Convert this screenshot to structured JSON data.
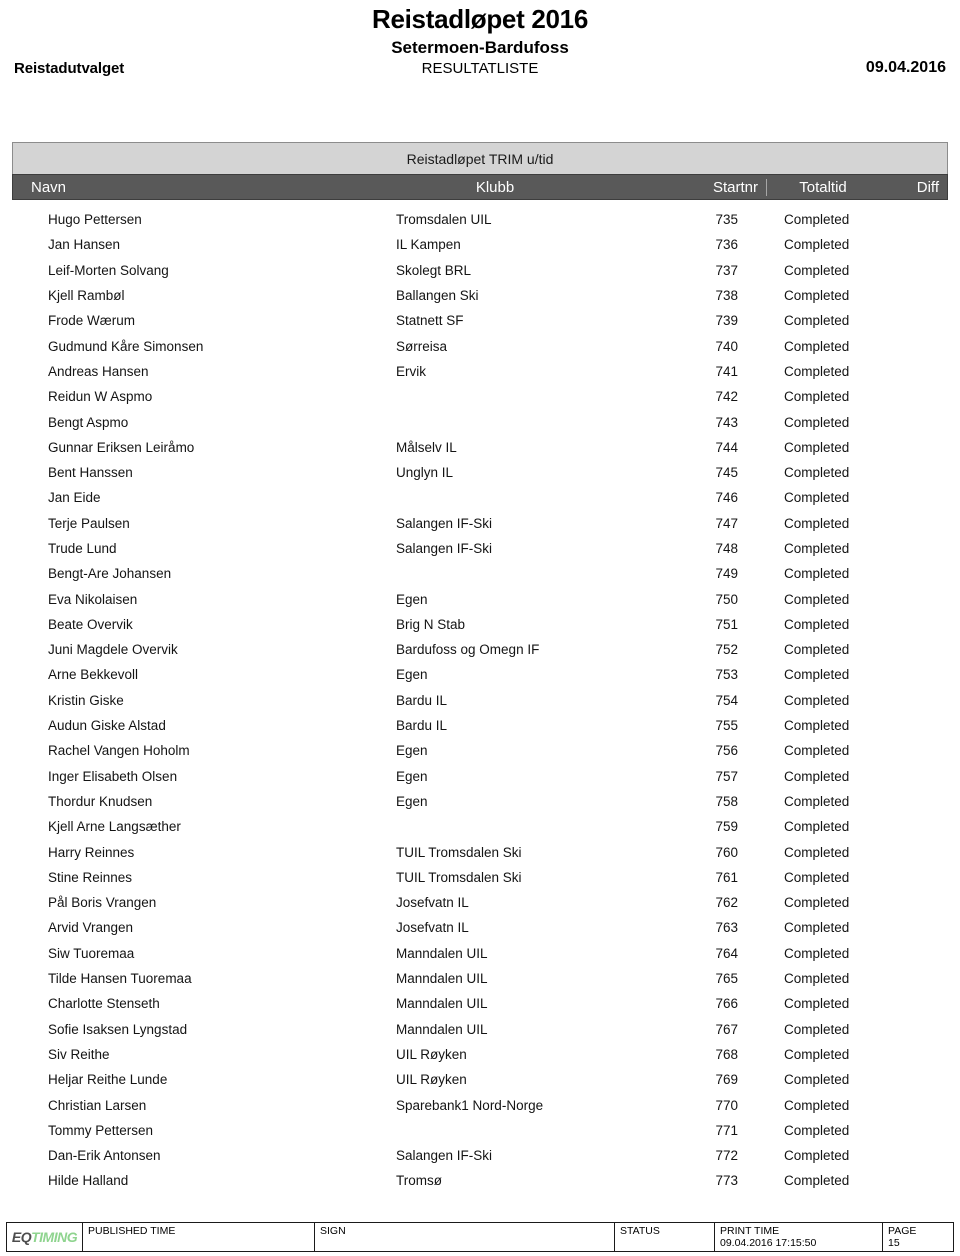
{
  "header": {
    "organizer": "Reistadutvalget",
    "event_title": "Reistadløpet 2016",
    "event_subtitle": "Setermoen-Bardufoss",
    "document_kind": "RESULTATLISTE",
    "date": "09.04.2016"
  },
  "table": {
    "class_band": "Reistadløpet TRIM u/tid",
    "columns": {
      "navn": "Navn",
      "klubb": "Klubb",
      "startnr": "Startnr",
      "totaltid": "Totaltid",
      "diff": "Diff"
    },
    "rows": [
      {
        "navn": "Hugo Pettersen",
        "klubb": "Tromsdalen UIL",
        "startnr": "735",
        "totaltid": "Completed",
        "diff": ""
      },
      {
        "navn": "Jan Hansen",
        "klubb": "IL Kampen",
        "startnr": "736",
        "totaltid": "Completed",
        "diff": ""
      },
      {
        "navn": "Leif-Morten Solvang",
        "klubb": "Skolegt BRL",
        "startnr": "737",
        "totaltid": "Completed",
        "diff": ""
      },
      {
        "navn": "Kjell Rambøl",
        "klubb": "Ballangen Ski",
        "startnr": "738",
        "totaltid": "Completed",
        "diff": ""
      },
      {
        "navn": "Frode Wærum",
        "klubb": "Statnett SF",
        "startnr": "739",
        "totaltid": "Completed",
        "diff": ""
      },
      {
        "navn": "Gudmund Kåre Simonsen",
        "klubb": "Sørreisa",
        "startnr": "740",
        "totaltid": "Completed",
        "diff": ""
      },
      {
        "navn": "Andreas Hansen",
        "klubb": "Ervik",
        "startnr": "741",
        "totaltid": "Completed",
        "diff": ""
      },
      {
        "navn": "Reidun W Aspmo",
        "klubb": "",
        "startnr": "742",
        "totaltid": "Completed",
        "diff": ""
      },
      {
        "navn": "Bengt Aspmo",
        "klubb": "",
        "startnr": "743",
        "totaltid": "Completed",
        "diff": ""
      },
      {
        "navn": "Gunnar Eriksen Leiråmo",
        "klubb": "Målselv IL",
        "startnr": "744",
        "totaltid": "Completed",
        "diff": ""
      },
      {
        "navn": "Bent Hanssen",
        "klubb": "Unglyn IL",
        "startnr": "745",
        "totaltid": "Completed",
        "diff": ""
      },
      {
        "navn": "Jan Eide",
        "klubb": "",
        "startnr": "746",
        "totaltid": "Completed",
        "diff": ""
      },
      {
        "navn": "Terje Paulsen",
        "klubb": "Salangen IF-Ski",
        "startnr": "747",
        "totaltid": "Completed",
        "diff": ""
      },
      {
        "navn": "Trude Lund",
        "klubb": "Salangen IF-Ski",
        "startnr": "748",
        "totaltid": "Completed",
        "diff": ""
      },
      {
        "navn": "Bengt-Are Johansen",
        "klubb": "",
        "startnr": "749",
        "totaltid": "Completed",
        "diff": ""
      },
      {
        "navn": "Eva Nikolaisen",
        "klubb": "Egen",
        "startnr": "750",
        "totaltid": "Completed",
        "diff": ""
      },
      {
        "navn": "Beate Overvik",
        "klubb": "Brig N Stab",
        "startnr": "751",
        "totaltid": "Completed",
        "diff": ""
      },
      {
        "navn": "Juni Magdele Overvik",
        "klubb": "Bardufoss og Omegn IF",
        "startnr": "752",
        "totaltid": "Completed",
        "diff": ""
      },
      {
        "navn": "Arne Bekkevoll",
        "klubb": "Egen",
        "startnr": "753",
        "totaltid": "Completed",
        "diff": ""
      },
      {
        "navn": "Kristin Giske",
        "klubb": "Bardu IL",
        "startnr": "754",
        "totaltid": "Completed",
        "diff": ""
      },
      {
        "navn": "Audun Giske Alstad",
        "klubb": "Bardu IL",
        "startnr": "755",
        "totaltid": "Completed",
        "diff": ""
      },
      {
        "navn": "Rachel Vangen Hoholm",
        "klubb": "Egen",
        "startnr": "756",
        "totaltid": "Completed",
        "diff": ""
      },
      {
        "navn": "Inger Elisabeth Olsen",
        "klubb": "Egen",
        "startnr": "757",
        "totaltid": "Completed",
        "diff": ""
      },
      {
        "navn": "Thordur Knudsen",
        "klubb": "Egen",
        "startnr": "758",
        "totaltid": "Completed",
        "diff": ""
      },
      {
        "navn": "Kjell Arne Langsæther",
        "klubb": "",
        "startnr": "759",
        "totaltid": "Completed",
        "diff": ""
      },
      {
        "navn": "Harry Reinnes",
        "klubb": "TUIL Tromsdalen Ski",
        "startnr": "760",
        "totaltid": "Completed",
        "diff": ""
      },
      {
        "navn": "Stine Reinnes",
        "klubb": "TUIL Tromsdalen Ski",
        "startnr": "761",
        "totaltid": "Completed",
        "diff": ""
      },
      {
        "navn": "Pål Boris Vrangen",
        "klubb": "Josefvatn IL",
        "startnr": "762",
        "totaltid": "Completed",
        "diff": ""
      },
      {
        "navn": "Arvid Vrangen",
        "klubb": "Josefvatn IL",
        "startnr": "763",
        "totaltid": "Completed",
        "diff": ""
      },
      {
        "navn": "Siw Tuoremaa",
        "klubb": "Manndalen UIL",
        "startnr": "764",
        "totaltid": "Completed",
        "diff": ""
      },
      {
        "navn": "Tilde Hansen Tuoremaa",
        "klubb": "Manndalen UIL",
        "startnr": "765",
        "totaltid": "Completed",
        "diff": ""
      },
      {
        "navn": "Charlotte Stenseth",
        "klubb": "Manndalen UIL",
        "startnr": "766",
        "totaltid": "Completed",
        "diff": ""
      },
      {
        "navn": "Sofie Isaksen Lyngstad",
        "klubb": "Manndalen UIL",
        "startnr": "767",
        "totaltid": "Completed",
        "diff": ""
      },
      {
        "navn": "Siv Reithe",
        "klubb": "UIL Røyken",
        "startnr": "768",
        "totaltid": "Completed",
        "diff": ""
      },
      {
        "navn": "Heljar Reithe Lunde",
        "klubb": "UIL Røyken",
        "startnr": "769",
        "totaltid": "Completed",
        "diff": ""
      },
      {
        "navn": "Christian Larsen",
        "klubb": "Sparebank1 Nord-Norge",
        "startnr": "770",
        "totaltid": "Completed",
        "diff": ""
      },
      {
        "navn": "Tommy Pettersen",
        "klubb": "",
        "startnr": "771",
        "totaltid": "Completed",
        "diff": ""
      },
      {
        "navn": "Dan-Erik Antonsen",
        "klubb": "Salangen IF-Ski",
        "startnr": "772",
        "totaltid": "Completed",
        "diff": ""
      },
      {
        "navn": "Hilde Halland",
        "klubb": "Tromsø",
        "startnr": "773",
        "totaltid": "Completed",
        "diff": ""
      }
    ]
  },
  "footer": {
    "logo_part1": "EQ",
    "logo_part2": "TIMING",
    "published_time_label": "PUBLISHED TIME",
    "published_time_value": "",
    "sign_label": "SIGN",
    "sign_value": "",
    "status_label": "STATUS",
    "status_value": "",
    "print_time_label": "PRINT TIME",
    "print_time_value": "09.04.2016 17:15:50",
    "page_label": "PAGE",
    "page_value": "15"
  },
  "colors": {
    "class_band_bg": "#d4d4d4",
    "col_head_bg": "#595959",
    "logo_green": "#8fd48f",
    "logo_gray": "#4d4d4d"
  }
}
